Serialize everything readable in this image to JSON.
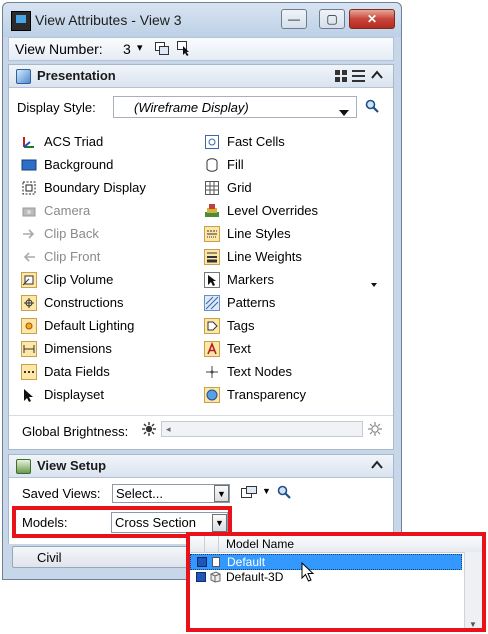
{
  "window": {
    "title": "View Attributes - View 3",
    "buttons": {
      "minimize": "—",
      "maximize": "▢",
      "close": "✕"
    }
  },
  "toolbar": {
    "view_number_label": "View Number:",
    "view_number_value": "3",
    "dropdown_glyph": "▾"
  },
  "presentation": {
    "title": "Presentation",
    "display_style_label": "Display Style:",
    "display_style_value": "(Wireframe Display)",
    "left_items": [
      {
        "label": "ACS Triad",
        "icon": "acs-triad-icon",
        "enabled": true
      },
      {
        "label": "Background",
        "icon": "background-icon",
        "enabled": true
      },
      {
        "label": "Boundary Display",
        "icon": "boundary-display-icon",
        "enabled": true
      },
      {
        "label": "Camera",
        "icon": "camera-icon",
        "enabled": false
      },
      {
        "label": "Clip Back",
        "icon": "clip-back-icon",
        "enabled": false
      },
      {
        "label": "Clip Front",
        "icon": "clip-front-icon",
        "enabled": false
      },
      {
        "label": "Clip Volume",
        "icon": "clip-volume-icon",
        "enabled": true
      },
      {
        "label": "Constructions",
        "icon": "constructions-icon",
        "enabled": true
      },
      {
        "label": "Default Lighting",
        "icon": "default-lighting-icon",
        "enabled": true
      },
      {
        "label": "Dimensions",
        "icon": "dimensions-icon",
        "enabled": true
      },
      {
        "label": "Data Fields",
        "icon": "data-fields-icon",
        "enabled": true
      },
      {
        "label": "Displayset",
        "icon": "displayset-icon",
        "enabled": true
      }
    ],
    "right_items": [
      {
        "label": "Fast Cells",
        "icon": "fast-cells-icon"
      },
      {
        "label": "Fill",
        "icon": "fill-icon"
      },
      {
        "label": "Grid",
        "icon": "grid-icon"
      },
      {
        "label": "Level Overrides",
        "icon": "level-overrides-icon"
      },
      {
        "label": "Line Styles",
        "icon": "line-styles-icon"
      },
      {
        "label": "Line Weights",
        "icon": "line-weights-icon"
      },
      {
        "label": "Markers",
        "icon": "markers-icon"
      },
      {
        "label": "Patterns",
        "icon": "patterns-icon"
      },
      {
        "label": "Tags",
        "icon": "tags-icon"
      },
      {
        "label": "Text",
        "icon": "text-icon"
      },
      {
        "label": "Text Nodes",
        "icon": "text-nodes-icon"
      },
      {
        "label": "Transparency",
        "icon": "transparency-icon"
      }
    ],
    "global_brightness_label": "Global Brightness:"
  },
  "view_setup": {
    "title": "View Setup",
    "saved_views_label": "Saved Views:",
    "saved_views_value": "Select...",
    "models_label": "Models:",
    "models_value": "Cross Section",
    "bottom_tab_label": "Civil"
  },
  "model_dropdown": {
    "column_header": "Model Name",
    "rows": [
      {
        "name": "Default",
        "selected": true
      },
      {
        "name": "Default-3D",
        "selected": false
      }
    ]
  },
  "colors": {
    "highlight_red": "#e8121a",
    "selection_blue": "#3399ff",
    "window_frame": "#c7d6e8"
  }
}
